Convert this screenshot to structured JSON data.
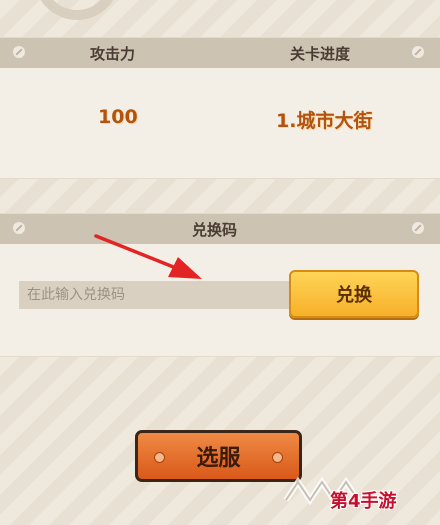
{
  "stats": {
    "attack_label": "攻击力",
    "progress_label": "关卡进度",
    "attack_value": "100",
    "progress_value": "1.城市大街"
  },
  "redeem": {
    "title": "兑换码",
    "placeholder": "在此输入兑换码",
    "button_label": "兑换"
  },
  "select_server_label": "选服",
  "watermark": {
    "text": "第4手游"
  },
  "colors": {
    "accent_orange": "#d9591a",
    "redeem_yellow": "#f6b02a",
    "value_text": "#b25410",
    "arrow_red": "#e32424"
  }
}
